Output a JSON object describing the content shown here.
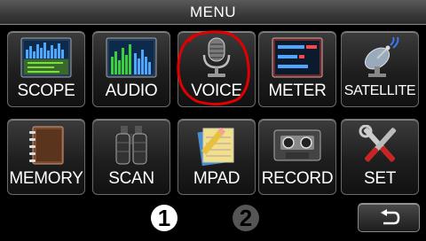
{
  "title": "MENU",
  "tiles": [
    {
      "label": "SCOPE",
      "icon": "scope-icon"
    },
    {
      "label": "AUDIO",
      "icon": "audio-icon"
    },
    {
      "label": "VOICE",
      "icon": "microphone-icon"
    },
    {
      "label": "METER",
      "icon": "meter-icon"
    },
    {
      "label": "SATELLITE",
      "icon": "satellite-dish-icon"
    },
    {
      "label": "MEMORY",
      "icon": "notebook-icon"
    },
    {
      "label": "SCAN",
      "icon": "binoculars-icon"
    },
    {
      "label": "MPAD",
      "icon": "notepad-pencil-icon"
    },
    {
      "label": "RECORD",
      "icon": "cassette-tape-icon"
    },
    {
      "label": "SET",
      "icon": "tools-icon"
    }
  ],
  "pager": {
    "page1": "1",
    "page2": "2",
    "current": 1
  },
  "back": {
    "icon": "return-arrow-icon"
  },
  "colors": {
    "highlight": "#e00000",
    "background": "#000000"
  }
}
